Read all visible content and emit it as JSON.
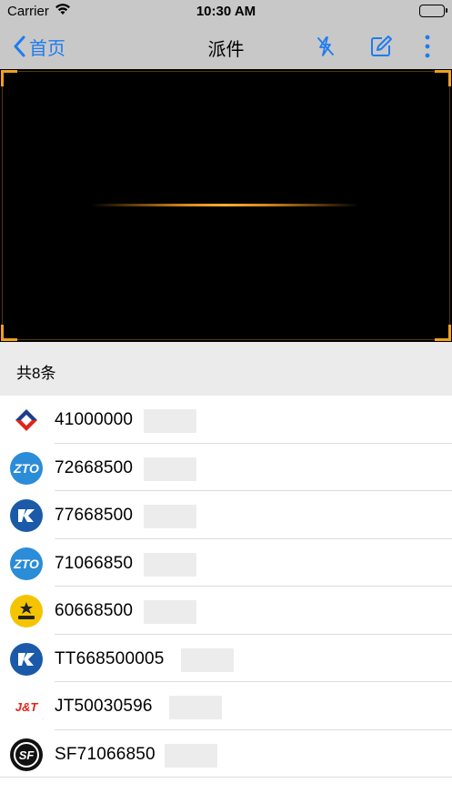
{
  "status_bar": {
    "carrier": "Carrier",
    "time": "10:30 AM"
  },
  "nav": {
    "back_label": "首页",
    "title": "派件"
  },
  "list": {
    "count_label": "共8条",
    "items": [
      {
        "number": "41000000",
        "carrier": "debang-icon"
      },
      {
        "number": "72668500",
        "carrier": "zto-icon"
      },
      {
        "number": "77668500",
        "carrier": "kuayue-icon"
      },
      {
        "number": "71066850",
        "carrier": "zto-icon"
      },
      {
        "number": "60668500",
        "carrier": "yunda-icon"
      },
      {
        "number": "TT668500005",
        "carrier": "kuayue-icon"
      },
      {
        "number": "JT50030596",
        "carrier": "jt-icon"
      },
      {
        "number": "SF71066850",
        "carrier": "sf-icon"
      }
    ]
  },
  "colors": {
    "accent": "#1e7cf0",
    "scan": "#f0a020",
    "bar": "#c8c8c8"
  }
}
